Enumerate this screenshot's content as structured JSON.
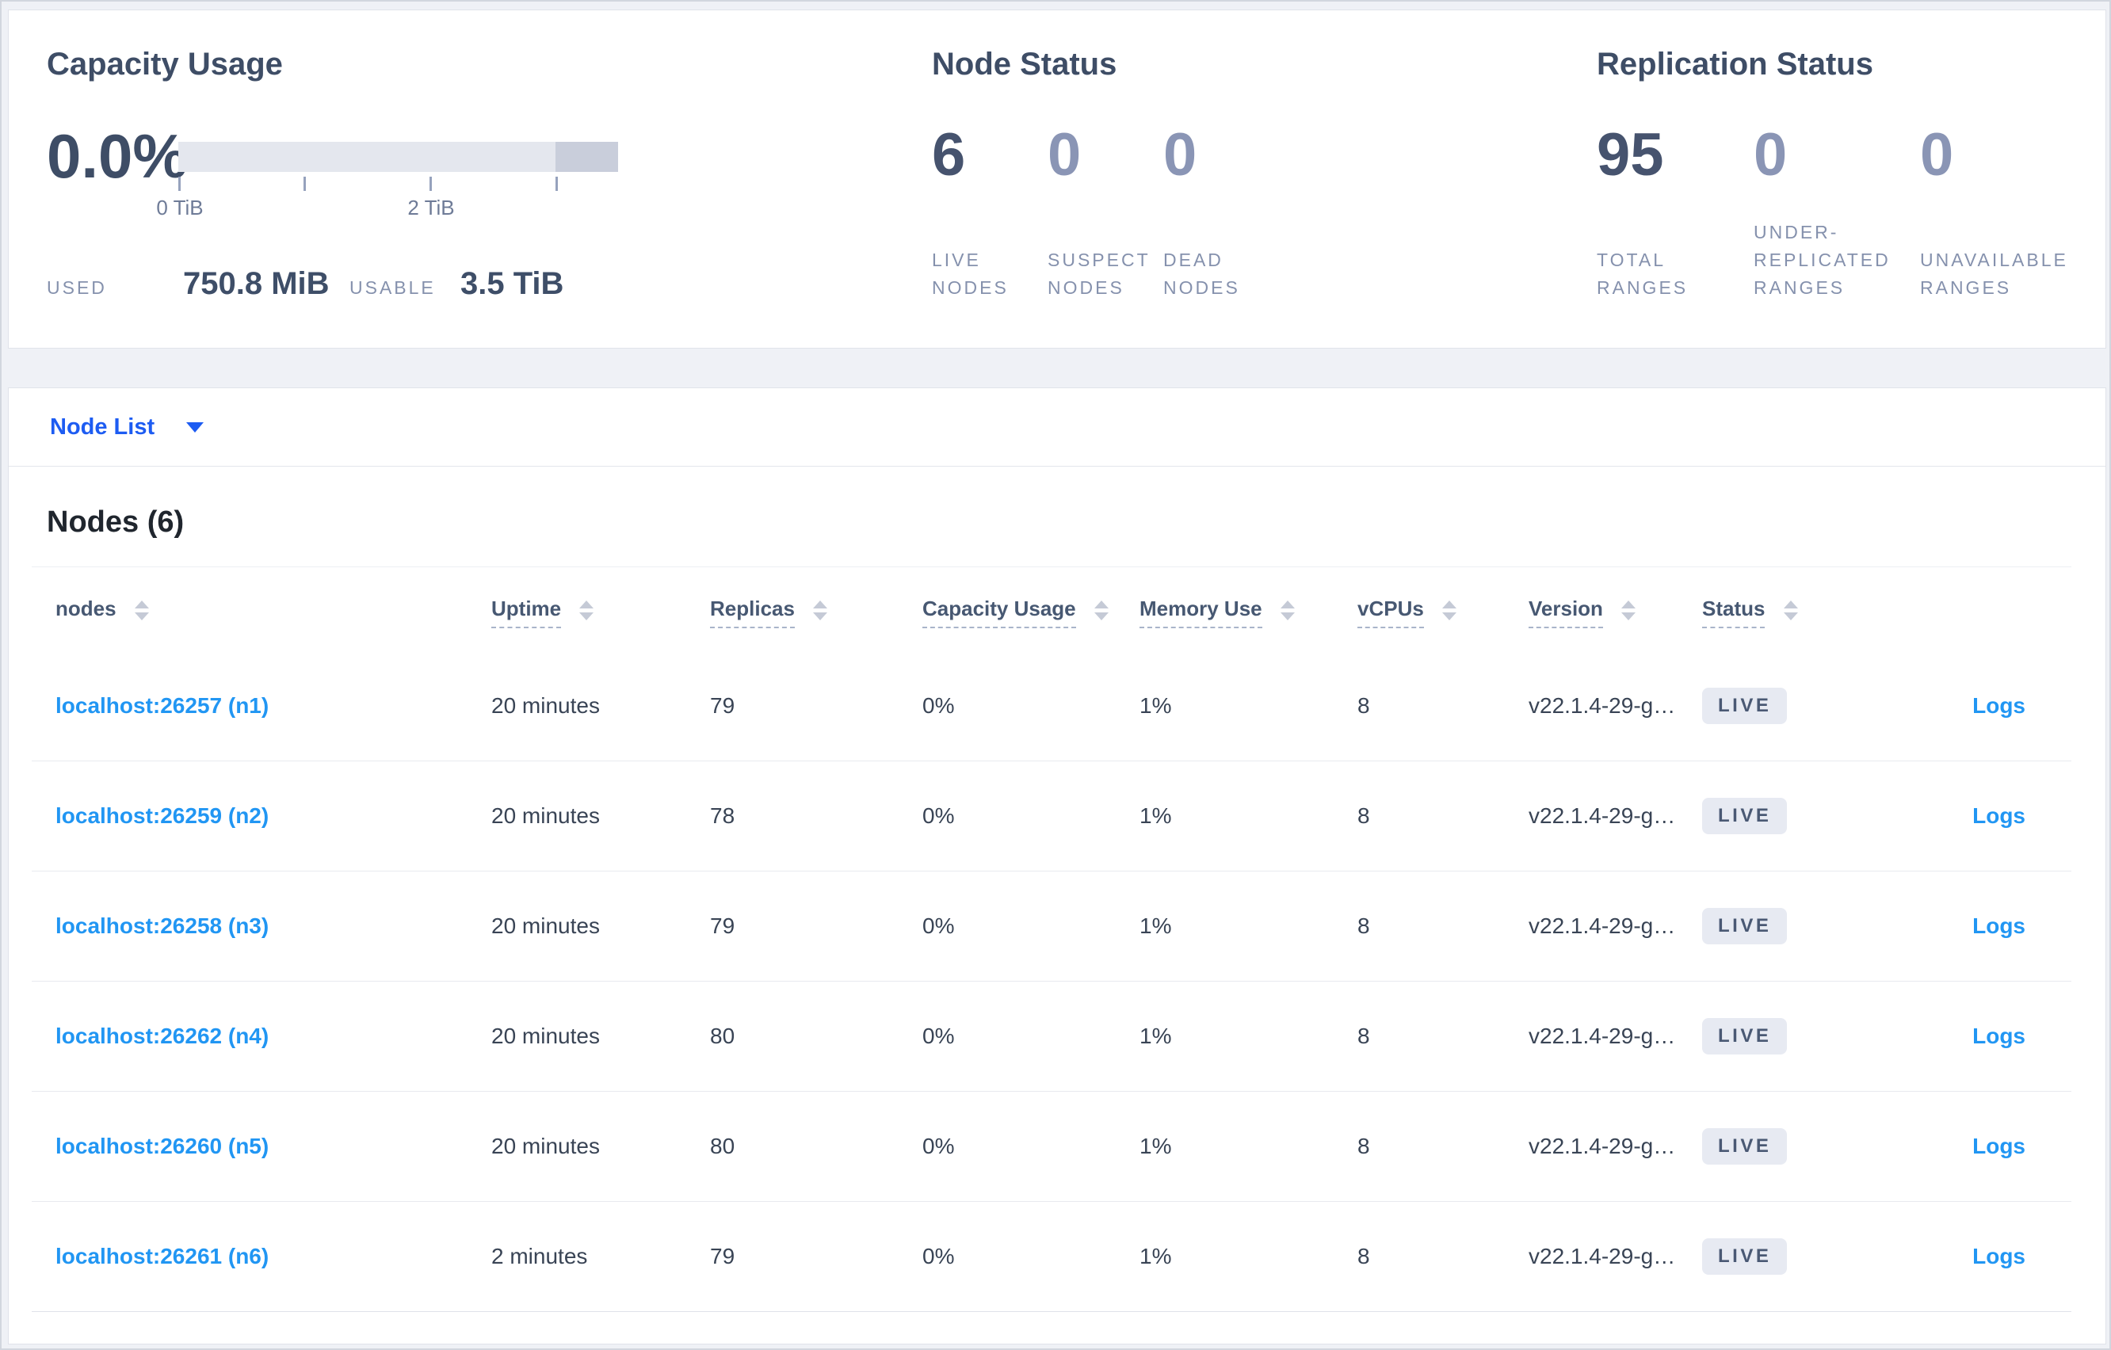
{
  "stats": {
    "capacity": {
      "title": "Capacity Usage",
      "percent": "0.0%",
      "ticks": [
        "0 TiB",
        "2 TiB"
      ],
      "used_label": "USED",
      "used_value": "750.8 MiB",
      "usable_label": "USABLE",
      "usable_value": "3.5 TiB"
    },
    "node_status": {
      "title": "Node Status",
      "cols": [
        {
          "value": "6",
          "label": "LIVE NODES"
        },
        {
          "value": "0",
          "label": "SUSPECT NODES"
        },
        {
          "value": "0",
          "label": "DEAD NODES"
        }
      ]
    },
    "replication": {
      "title": "Replication Status",
      "cols": [
        {
          "value": "95",
          "label": "TOTAL RANGES"
        },
        {
          "value": "0",
          "label": "UNDER-REPLICATED RANGES"
        },
        {
          "value": "0",
          "label": "UNAVAILABLE RANGES"
        }
      ]
    }
  },
  "node_list": {
    "label": "Node List"
  },
  "table": {
    "title": "Nodes (6)",
    "headers": [
      "nodes",
      "Uptime",
      "Replicas",
      "Capacity Usage",
      "Memory Use",
      "vCPUs",
      "Version",
      "Status"
    ],
    "logs_label": "Logs",
    "rows": [
      {
        "node": "localhost:26257 (n1)",
        "uptime": "20 minutes",
        "replicas": "79",
        "capacity": "0%",
        "memory": "1%",
        "vcpus": "8",
        "version": "v22.1.4-29-g…",
        "status": "LIVE"
      },
      {
        "node": "localhost:26259 (n2)",
        "uptime": "20 minutes",
        "replicas": "78",
        "capacity": "0%",
        "memory": "1%",
        "vcpus": "8",
        "version": "v22.1.4-29-g…",
        "status": "LIVE"
      },
      {
        "node": "localhost:26258 (n3)",
        "uptime": "20 minutes",
        "replicas": "79",
        "capacity": "0%",
        "memory": "1%",
        "vcpus": "8",
        "version": "v22.1.4-29-g…",
        "status": "LIVE"
      },
      {
        "node": "localhost:26262 (n4)",
        "uptime": "20 minutes",
        "replicas": "80",
        "capacity": "0%",
        "memory": "1%",
        "vcpus": "8",
        "version": "v22.1.4-29-g…",
        "status": "LIVE"
      },
      {
        "node": "localhost:26260 (n5)",
        "uptime": "20 minutes",
        "replicas": "80",
        "capacity": "0%",
        "memory": "1%",
        "vcpus": "8",
        "version": "v22.1.4-29-g…",
        "status": "LIVE"
      },
      {
        "node": "localhost:26261 (n6)",
        "uptime": "2 minutes",
        "replicas": "79",
        "capacity": "0%",
        "memory": "1%",
        "vcpus": "8",
        "version": "v22.1.4-29-g…",
        "status": "LIVE"
      }
    ]
  },
  "colors": {
    "accent_blue": "#1d5cf2",
    "link_blue": "#2196f3",
    "badge_bg": "#e7eaf2",
    "badge_text": "#4a5974",
    "bar_light": "#e4e7ee",
    "bar_dark": "#c9cedb"
  }
}
